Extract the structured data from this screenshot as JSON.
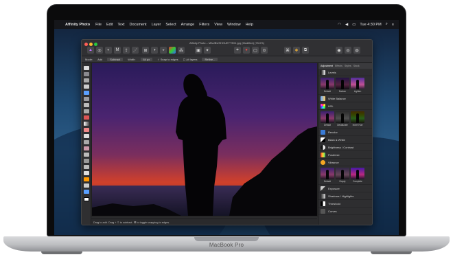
{
  "device": {
    "brand_label": "MacBook Pro"
  },
  "menubar": {
    "app_name": "Affinity Photo",
    "items": [
      "File",
      "Edit",
      "Text",
      "Document",
      "Layer",
      "Select",
      "Arrange",
      "Filters",
      "View",
      "Window",
      "Help"
    ],
    "clock": "Tue 4:30 PM"
  },
  "window": {
    "title": "Affinity Photo – MAUBUSHOUETTE01.jpg (Modified) (75.0%)"
  },
  "context_toolbar": {
    "mode_label": "Mode:",
    "add_label": "Add",
    "subtract_label": "Subtract",
    "width_label": "Width:",
    "width_value": "64 px",
    "snap_label": "Snap to edges",
    "all_layers_label": "All layers",
    "refine_label": "Refine..."
  },
  "panel": {
    "tabs": [
      "Adjustment",
      "Effects",
      "Styles",
      "Stock"
    ],
    "active_tab": "Adjustment",
    "sections": [
      {
        "label": "Levels",
        "thumbs": [
          "Default",
          "Darken",
          "Lighten"
        ]
      },
      {
        "label": "White Balance"
      },
      {
        "label": "HSL",
        "thumbs": [
          "Default",
          "Desaturate",
          "Invert Hue"
        ]
      },
      {
        "label": "Recolor"
      },
      {
        "label": "Black & White"
      },
      {
        "label": "Brightness / Contrast"
      },
      {
        "label": "Posterize"
      },
      {
        "label": "Vibrance",
        "thumbs": [
          "Default",
          "Empty",
          "Complete"
        ]
      },
      {
        "label": "Exposure"
      },
      {
        "label": "Shadows / Highlights"
      },
      {
        "label": "Threshold"
      },
      {
        "label": "Curves"
      }
    ]
  },
  "statusbar": {
    "text": "Drag to add. Drag + ⇧ to subtract. ⌘ to toggle snapping to edges."
  },
  "colors": {
    "menubar_bg": "#15161a",
    "window_bg": "#2b2b2d",
    "sky_top": "#3a1f6e",
    "sky_bottom": "#e0442a"
  }
}
